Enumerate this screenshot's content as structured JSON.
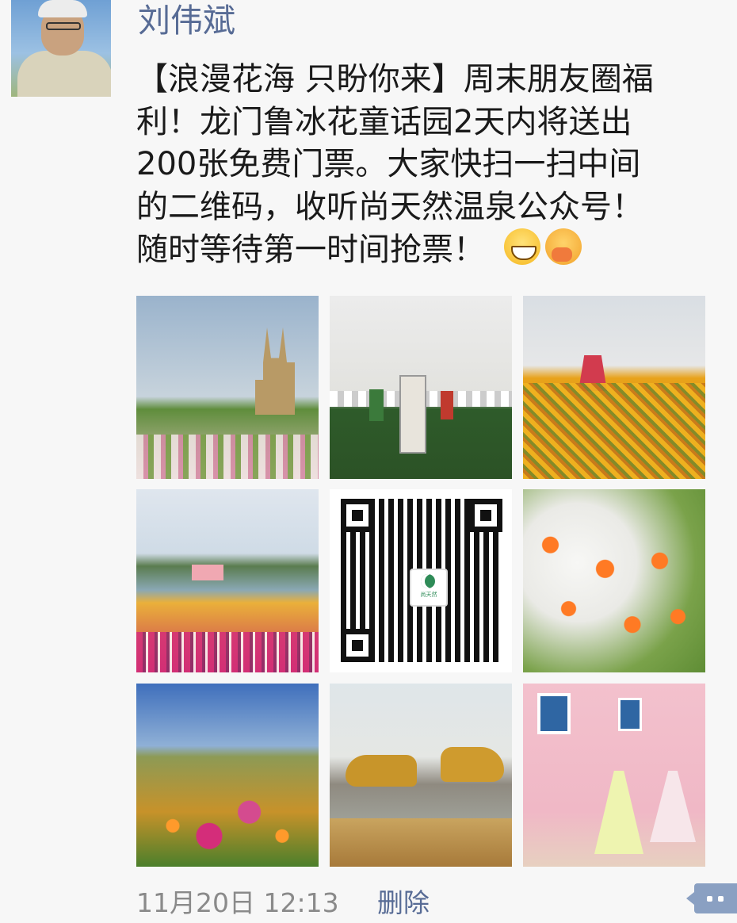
{
  "post": {
    "author_name": "刘伟斌",
    "content_lines": [
      "【浪漫花海 只盼你来】周末朋友圈福",
      "利！龙门鲁冰花童话园2天内将送出",
      "200张免费门票。大家快扫一扫中间",
      "的二维码，收听尚天然温泉公众号！",
      "随时等待第一时间抢票！"
    ],
    "emojis": [
      "grinning-face-emoji",
      "face-with-hand-over-mouth-emoji"
    ],
    "images": [
      {
        "name": "photo-castle-flowers"
      },
      {
        "name": "photo-fairytale-statues"
      },
      {
        "name": "photo-windmill-cosmos"
      },
      {
        "name": "photo-lake-flowerbeds"
      },
      {
        "name": "qr-code-image",
        "logo_text": "尚天然"
      },
      {
        "name": "photo-orange-cosmos"
      },
      {
        "name": "photo-hillside-cosmos"
      },
      {
        "name": "photo-golden-dragons-pond"
      },
      {
        "name": "photo-pink-house-brides"
      }
    ],
    "timestamp": "11月20日 12:13",
    "delete_label": "删除",
    "comment_icon": "comment-bubble-icon"
  },
  "colors": {
    "name_link": "#576b95",
    "timestamp": "#8a8a8a",
    "background": "#f7f7f7"
  }
}
